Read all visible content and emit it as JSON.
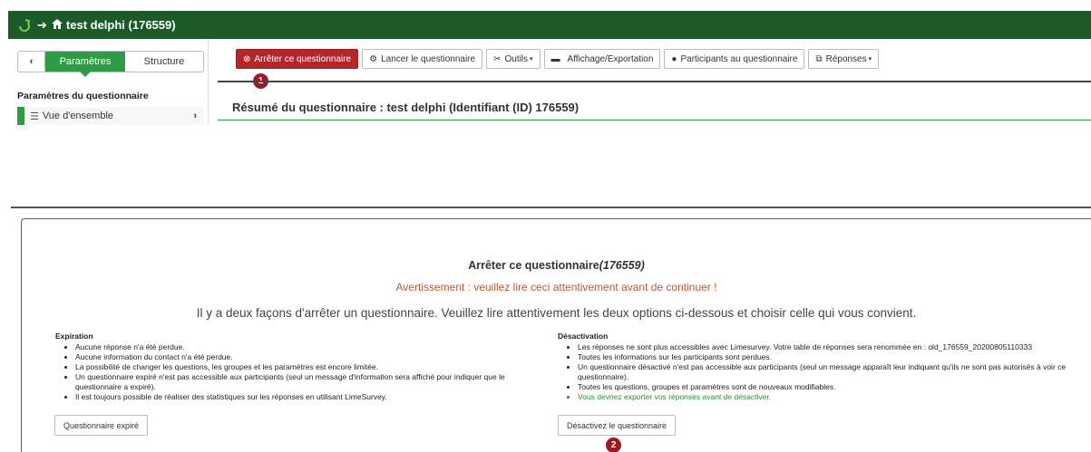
{
  "header": {
    "title": "test delphi (176559)"
  },
  "sidebar": {
    "tabs": [
      "Paramètres",
      "Structure"
    ],
    "section_title": "Paramètres du questionnaire",
    "items": [
      {
        "label": "Vue d'ensemble",
        "icon": "list-icon"
      }
    ]
  },
  "toolbar": {
    "stop_label": "Arrêter ce questionnaire",
    "launch_label": "Lancer le questionnaire",
    "tools_label": "Outils",
    "display_label": "Affichage/Exportation",
    "participants_label": "Participants au questionnaire",
    "responses_label": "Réponses"
  },
  "steps": [
    "1",
    "2"
  ],
  "summary": {
    "title": "Résumé du questionnaire : test delphi (Identifiant (ID) 176559)"
  },
  "stop_panel": {
    "title": "Arrêter ce questionnaire",
    "survey_id": "(176559)",
    "warning": "Avertissement : veuillez lire ceci attentivement avant de continuer !",
    "intro": "Il y a deux façons d'arrêter un questionnaire. Veuillez lire attentivement les deux options ci-dessous et choisir celle qui vous convient.",
    "expiration": {
      "heading": "Expiration",
      "items": [
        "Aucune réponse n'a été perdue.",
        "Aucune information du contact n'a été perdue.",
        "La possibilité de changer les questions, les groupes et les paramètres est encore limitée.",
        "Un questionnaire expiré n'est pas accessible aux participants (seul un message d'information sera affiché pour indiquer que le questionnaire a expiré).",
        "Il est toujours possible de réaliser des statistiques sur les réponses en utilisant LimeSurvey."
      ],
      "button_label": "Questionnaire expiré"
    },
    "deactivation": {
      "heading": "Désactivation",
      "items": [
        "Les réponses ne sont plus accessibles avec Limesurvey. Votre table de réponses sera renommée en : old_176559_20200805110333",
        "Toutes les informations sur les participants sont perdues.",
        "Un questionnaire désactivé n'est pas accessible aux participants (seul un message apparaît leur indiquant qu'ils ne sont pas autorisés à voir ce questionnaire).",
        "Toutes les questions, groupes et paramètres sont de nouveaux modifiables."
      ],
      "note": "Vous devriez exporter vos réponses avant de désactiver.",
      "button_label": "Désactivez le questionnaire"
    }
  },
  "colors": {
    "header_bg": "#1d5a29",
    "accent": "#2f9a48",
    "danger": "#b5262b",
    "warning": "#c7552a"
  }
}
